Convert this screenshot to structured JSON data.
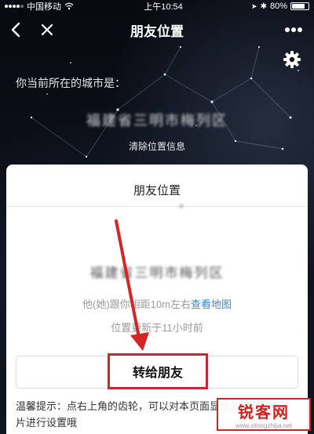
{
  "status_bar": {
    "carrier": "中国移动",
    "time": "上午10:54",
    "battery": "80%",
    "battery_level": 0.8
  },
  "nav": {
    "title": "朋友位置"
  },
  "header": {
    "current_city_label": "你当前所在的城市是：",
    "current_city": "福建省三明市梅列区",
    "clear_location": "清除位置信息"
  },
  "card": {
    "title": "朋友位置",
    "friend_city": "福建省三明市梅列区",
    "distance_prefix": "他(她)跟你相距10m左右",
    "view_map": "查看地图",
    "update_text": "位置更新于11小时前",
    "forward_button": "转给朋友",
    "tip_text": "温馨提示：点右上角的齿轮，可以对本页面显示的标题和图片进行设置哦"
  },
  "watermark": {
    "text": "锐客网",
    "url": "www.xitongzhijia.net"
  },
  "colors": {
    "accent_red": "#c8282a",
    "link_blue": "#3b84d6"
  },
  "icons": [
    "back-icon",
    "close-icon",
    "more-icon",
    "gear-icon",
    "wifi-icon",
    "signal-icon",
    "battery-icon"
  ]
}
